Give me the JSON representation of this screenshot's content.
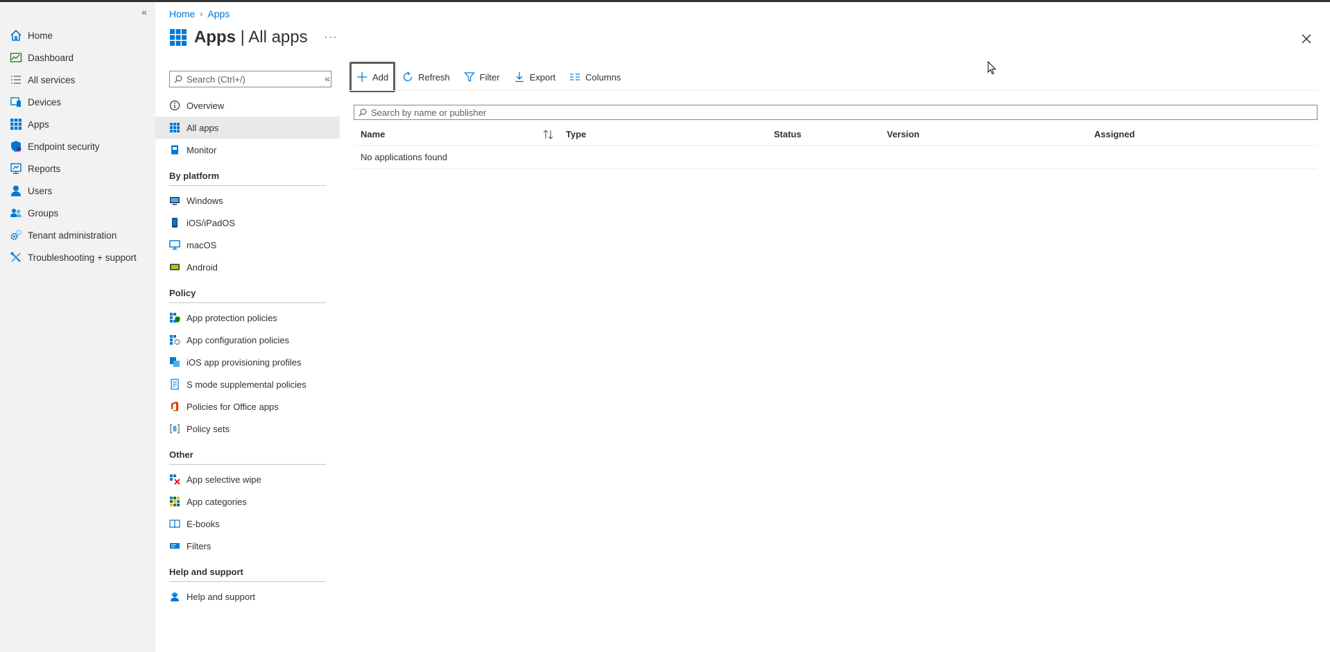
{
  "breadcrumb": [
    "Home",
    "Apps"
  ],
  "page": {
    "title_bold": "Apps",
    "title_rest": " | All apps",
    "more": "···"
  },
  "leftnav": {
    "items": [
      {
        "label": "Home",
        "icon": "home-icon"
      },
      {
        "label": "Dashboard",
        "icon": "dashboard-icon"
      },
      {
        "label": "All services",
        "icon": "list-icon"
      },
      {
        "label": "Devices",
        "icon": "devices-icon"
      },
      {
        "label": "Apps",
        "icon": "apps-grid-icon"
      },
      {
        "label": "Endpoint security",
        "icon": "shield-icon"
      },
      {
        "label": "Reports",
        "icon": "reports-icon"
      },
      {
        "label": "Users",
        "icon": "user-icon"
      },
      {
        "label": "Groups",
        "icon": "groups-icon"
      },
      {
        "label": "Tenant administration",
        "icon": "gear-icon"
      },
      {
        "label": "Troubleshooting + support",
        "icon": "tools-icon"
      }
    ]
  },
  "subnav": {
    "search_placeholder": "Search (Ctrl+/)",
    "top": [
      "Overview",
      "All apps",
      "Monitor"
    ],
    "sections": [
      {
        "title": "By platform",
        "items": [
          "Windows",
          "iOS/iPadOS",
          "macOS",
          "Android"
        ]
      },
      {
        "title": "Policy",
        "items": [
          "App protection policies",
          "App configuration policies",
          "iOS app provisioning profiles",
          "S mode supplemental policies",
          "Policies for Office apps",
          "Policy sets"
        ]
      },
      {
        "title": "Other",
        "items": [
          "App selective wipe",
          "App categories",
          "E-books",
          "Filters"
        ]
      },
      {
        "title": "Help and support",
        "items": [
          "Help and support"
        ]
      }
    ]
  },
  "toolbar": {
    "add": "Add",
    "refresh": "Refresh",
    "filter": "Filter",
    "export": "Export",
    "columns": "Columns"
  },
  "search": {
    "placeholder": "Search by name or publisher"
  },
  "grid": {
    "columns": [
      "Name",
      "Type",
      "Status",
      "Version",
      "Assigned"
    ],
    "empty": "No applications found"
  },
  "colors": {
    "accent": "#0078d4",
    "nav_bg": "#f2f2f2",
    "text": "#323130"
  }
}
